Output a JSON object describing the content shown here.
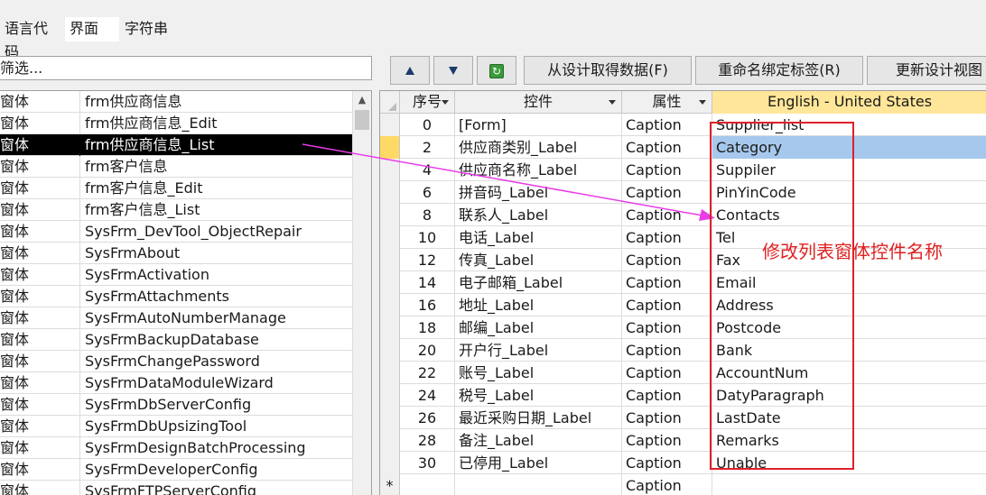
{
  "tabs": [
    {
      "label": "语言代码",
      "active": false
    },
    {
      "label": "界面",
      "active": true
    },
    {
      "label": "字符串",
      "active": false
    }
  ],
  "filter": {
    "label": "筛选..."
  },
  "left_list": {
    "selected_index": 2,
    "rows": [
      {
        "type": "窗体",
        "name": "frm供应商信息"
      },
      {
        "type": "窗体",
        "name": "frm供应商信息_Edit"
      },
      {
        "type": "窗体",
        "name": "frm供应商信息_List"
      },
      {
        "type": "窗体",
        "name": "frm客户信息"
      },
      {
        "type": "窗体",
        "name": "frm客户信息_Edit"
      },
      {
        "type": "窗体",
        "name": "frm客户信息_List"
      },
      {
        "type": "窗体",
        "name": "SysFrm_DevTool_ObjectRepair"
      },
      {
        "type": "窗体",
        "name": "SysFrmAbout"
      },
      {
        "type": "窗体",
        "name": "SysFrmActivation"
      },
      {
        "type": "窗体",
        "name": "SysFrmAttachments"
      },
      {
        "type": "窗体",
        "name": "SysFrmAutoNumberManage"
      },
      {
        "type": "窗体",
        "name": "SysFrmBackupDatabase"
      },
      {
        "type": "窗体",
        "name": "SysFrmChangePassword"
      },
      {
        "type": "窗体",
        "name": "SysFrmDataModuleWizard"
      },
      {
        "type": "窗体",
        "name": "SysFrmDbServerConfig"
      },
      {
        "type": "窗体",
        "name": "SysFrmDbUpsizingTool"
      },
      {
        "type": "窗体",
        "name": "SysFrmDesignBatchProcessing"
      },
      {
        "type": "窗体",
        "name": "SysFrmDeveloperConfig"
      },
      {
        "type": "窗体",
        "name": "SysFrmFTPServerConfig"
      }
    ]
  },
  "toolbar": {
    "move_up_icon": "arrow-up-icon",
    "move_down_icon": "arrow-down-icon",
    "refresh_icon": "refresh-icon",
    "fetch_label": "从设计取得数据(F)",
    "rename_label": "重命名绑定标签(R)",
    "update_label": "更新设计视图"
  },
  "grid": {
    "headers": {
      "seq": "序号",
      "control": "控件",
      "property": "属性",
      "language": "English - United States"
    },
    "current_row": 1,
    "rows": [
      {
        "seq": "0",
        "control": "[Form]",
        "property": "Caption",
        "value": "Supplier_list"
      },
      {
        "seq": "2",
        "control": "供应商类别_Label",
        "property": "Caption",
        "value": "Category"
      },
      {
        "seq": "4",
        "control": "供应商名称_Label",
        "property": "Caption",
        "value": "Suppiler"
      },
      {
        "seq": "6",
        "control": "拼音码_Label",
        "property": "Caption",
        "value": "PinYinCode"
      },
      {
        "seq": "8",
        "control": "联系人_Label",
        "property": "Caption",
        "value": "Contacts"
      },
      {
        "seq": "10",
        "control": "电话_Label",
        "property": "Caption",
        "value": "Tel"
      },
      {
        "seq": "12",
        "control": "传真_Label",
        "property": "Caption",
        "value": "Fax"
      },
      {
        "seq": "14",
        "control": "电子邮箱_Label",
        "property": "Caption",
        "value": "Email"
      },
      {
        "seq": "16",
        "control": "地址_Label",
        "property": "Caption",
        "value": "Address"
      },
      {
        "seq": "18",
        "control": "邮编_Label",
        "property": "Caption",
        "value": "Postcode"
      },
      {
        "seq": "20",
        "control": "开户行_Label",
        "property": "Caption",
        "value": "Bank"
      },
      {
        "seq": "22",
        "control": "账号_Label",
        "property": "Caption",
        "value": "AccountNum"
      },
      {
        "seq": "24",
        "control": "税号_Label",
        "property": "Caption",
        "value": "DatyParagraph"
      },
      {
        "seq": "26",
        "control": "最近采购日期_Label",
        "property": "Caption",
        "value": "LastDate"
      },
      {
        "seq": "28",
        "control": "备注_Label",
        "property": "Caption",
        "value": "Remarks"
      },
      {
        "seq": "30",
        "control": "已停用_Label",
        "property": "Caption",
        "value": "Unable"
      }
    ],
    "new_row": {
      "marker": "*",
      "property": "Caption"
    }
  },
  "annotation": {
    "note": "修改列表窗体控件名称",
    "color": "#e02020",
    "arrow_color": "#e83ce8"
  }
}
